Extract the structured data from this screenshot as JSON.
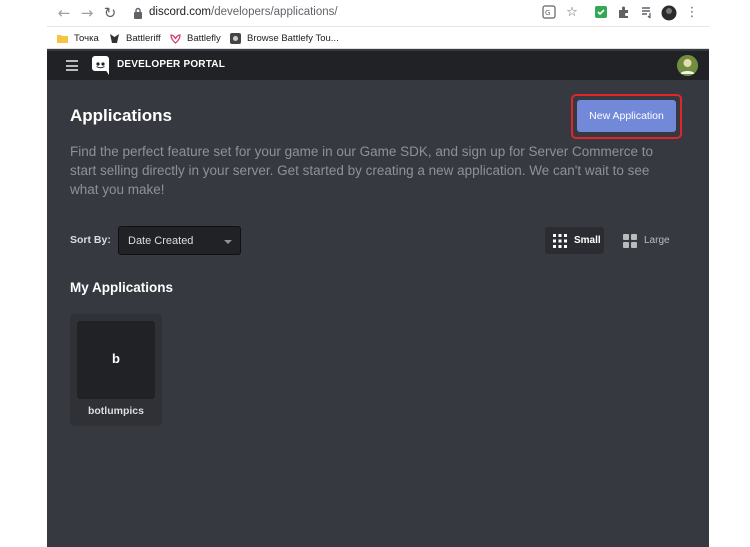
{
  "browser": {
    "url_host": "discord.com",
    "url_path": "/developers/applications/",
    "bookmarks": [
      {
        "label": "Точка",
        "icon": "folder-icon"
      },
      {
        "label": "Battleriff",
        "icon": "battleriff-icon"
      },
      {
        "label": "Battlefly",
        "icon": "battlefly-icon"
      },
      {
        "label": "Browse Battlefy Tou...",
        "icon": "battlefy-icon"
      }
    ]
  },
  "header": {
    "portal_title": "DEVELOPER PORTAL"
  },
  "main": {
    "title": "Applications",
    "new_app_label": "New Application",
    "description": "Find the perfect feature set for your game in our Game SDK, and sign up for Server Commerce to start selling directly in your server. Get started by creating a new application. We can't wait to see what you make!",
    "sort_label": "Sort By:",
    "sort_value": "Date Created",
    "view_small_label": "Small",
    "view_large_label": "Large",
    "section_title": "My Applications",
    "apps": [
      {
        "icon_letter": "b",
        "name": "botlumpics"
      }
    ]
  },
  "colors": {
    "background": "#36393f",
    "header": "#202225",
    "accent": "#7289da",
    "highlight": "#e0262b"
  }
}
